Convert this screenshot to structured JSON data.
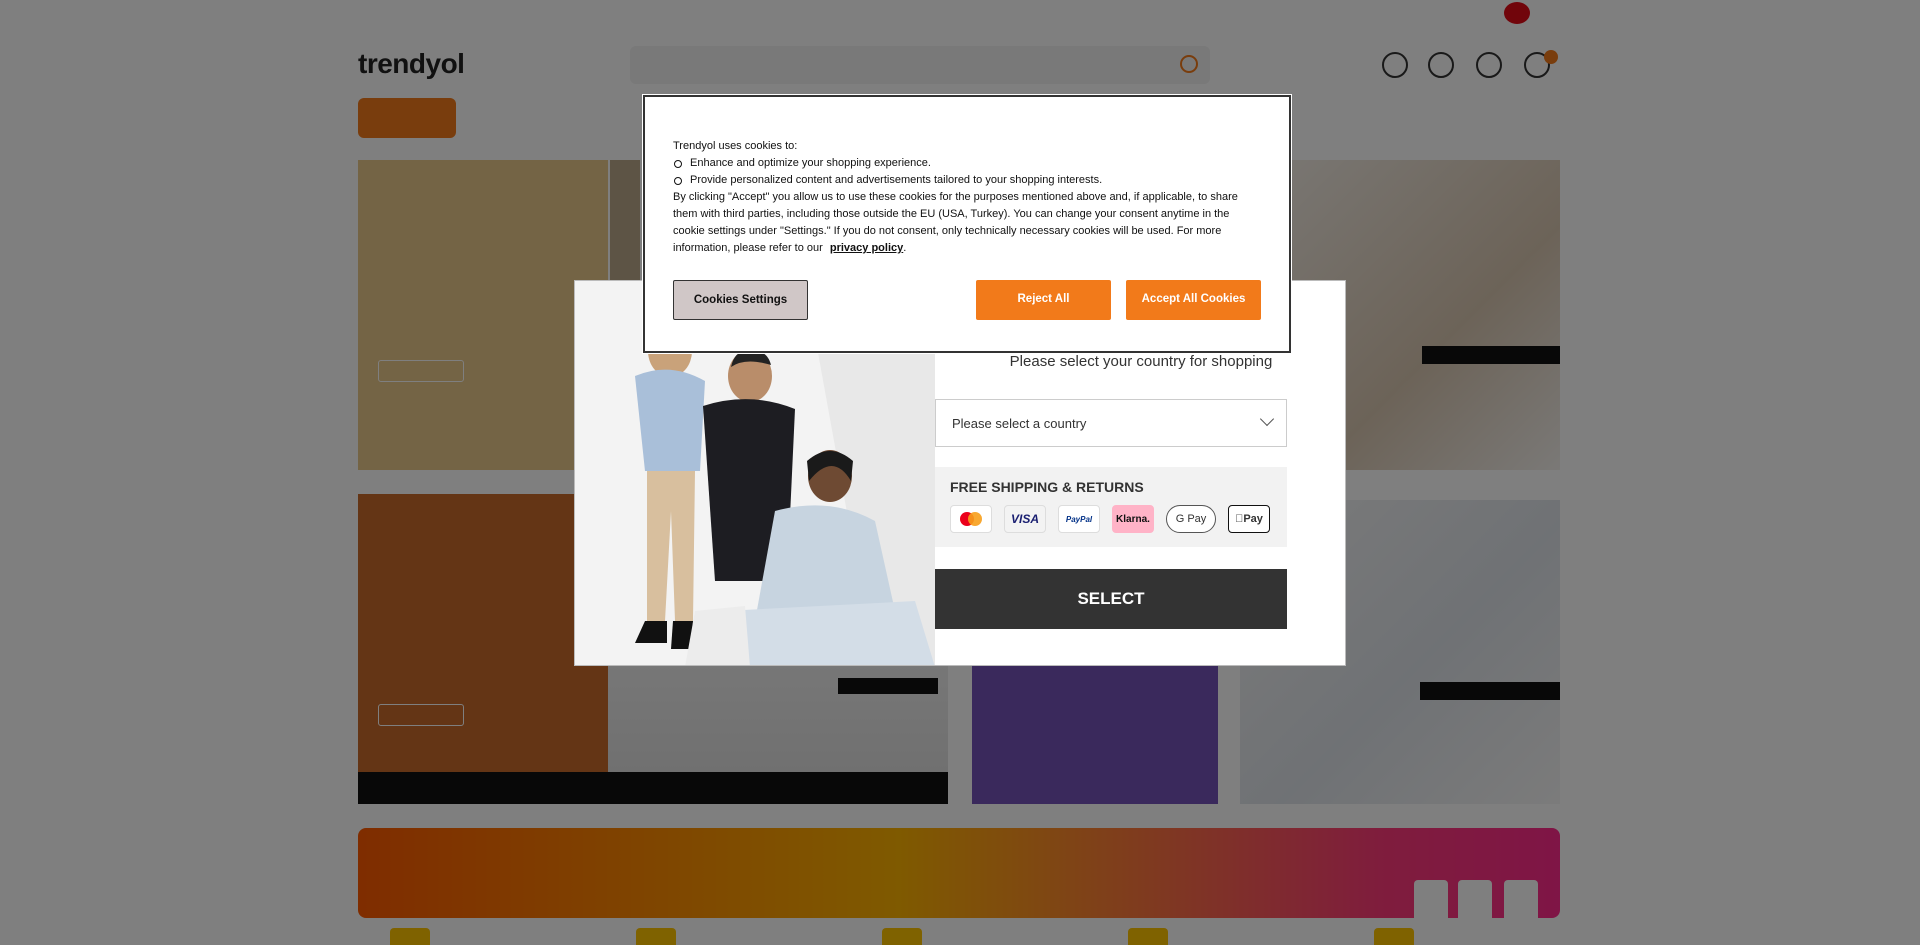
{
  "cookie_banner": {
    "intro": "Trendyol uses cookies to:",
    "bullets": [
      "Enhance and optimize your shopping experience.",
      "Provide personalized content and advertisements tailored to your shopping interests."
    ],
    "body": "By clicking \"Accept\" you allow us to use these cookies for the purposes mentioned above and, if applicable, to share them with third parties, including those outside the EU (USA, Turkey). You can change your consent anytime in the cookie settings under \"Settings.\" If you do not consent, only technically necessary cookies will be used. For more information, please refer to our",
    "link_text": "privacy policy",
    "link_suffix": ".",
    "settings_label": "Cookies Settings",
    "reject_label": "Reject All",
    "accept_label": "Accept All Cookies"
  },
  "country_modal": {
    "subtitle": "Please select your country for shopping",
    "select_placeholder": "Please select a country",
    "shipping_title": "FREE SHIPPING & RETURNS",
    "payment_methods": [
      "Mastercard",
      "VISA",
      "PayPal",
      "Klarna.",
      "G Pay",
      "Pay"
    ],
    "select_button": "SELECT"
  },
  "colors": {
    "brand_orange": "#f27a1a",
    "modal_button": "#333333",
    "settings_button": "#d0c7c7"
  },
  "icons": [
    "search-icon",
    "globe-icon",
    "user-icon",
    "heart-icon",
    "cart-icon",
    "chevron-down-icon",
    "mastercard-icon",
    "visa-icon",
    "paypal-icon",
    "klarna-icon",
    "google-pay-icon",
    "apple-pay-icon"
  ]
}
